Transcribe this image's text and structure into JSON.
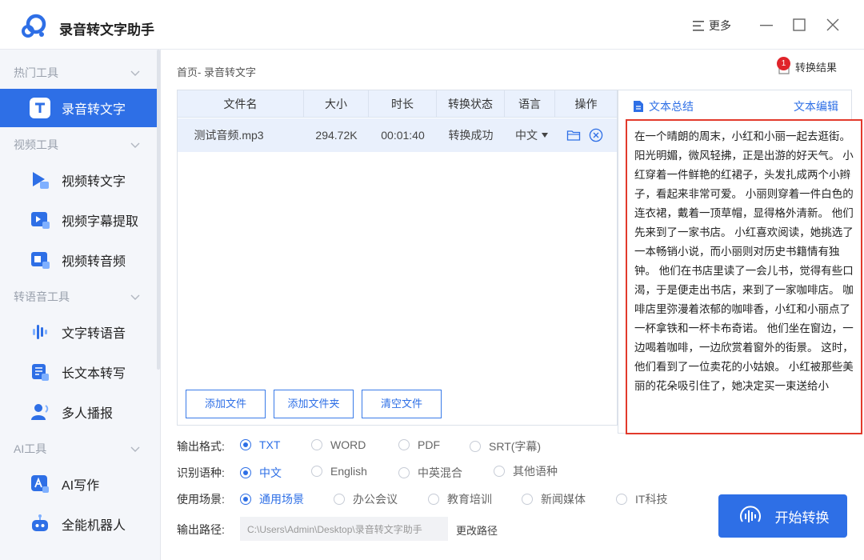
{
  "app": {
    "title": "录音转文字助手",
    "more_label": "更多"
  },
  "sidebar": {
    "groups": [
      {
        "label": "热门工具",
        "items": [
          {
            "label": "录音转文字",
            "icon": "text-t-icon",
            "active": true
          }
        ]
      },
      {
        "label": "视频工具",
        "items": [
          {
            "label": "视频转文字",
            "icon": "video-to-text-icon"
          },
          {
            "label": "视频字幕提取",
            "icon": "subtitle-extract-icon"
          },
          {
            "label": "视频转音频",
            "icon": "video-to-audio-icon"
          }
        ]
      },
      {
        "label": "转语音工具",
        "items": [
          {
            "label": "文字转语音",
            "icon": "waveform-icon"
          },
          {
            "label": "长文本转写",
            "icon": "long-text-icon"
          },
          {
            "label": "多人播报",
            "icon": "multi-speaker-icon"
          }
        ]
      },
      {
        "label": "AI工具",
        "items": [
          {
            "label": "AI写作",
            "icon": "ai-write-icon"
          },
          {
            "label": "全能机器人",
            "icon": "robot-icon"
          }
        ]
      }
    ]
  },
  "main": {
    "breadcrumb": "首页- 录音转文字",
    "result_label": "转换结果",
    "result_badge": "1",
    "table": {
      "headers": [
        "文件名",
        "大小",
        "时长",
        "转换状态",
        "语言",
        "操作"
      ],
      "rows": [
        {
          "name": "测试音频.mp3",
          "size": "294.72K",
          "duration": "00:01:40",
          "status": "转换成功",
          "language": "中文"
        }
      ]
    },
    "buttons": {
      "add_file": "添加文件",
      "add_folder": "添加文件夹",
      "clear": "清空文件"
    }
  },
  "text_panel": {
    "summary_label": "文本总结",
    "edit_label": "文本编辑",
    "content": "在一个晴朗的周末，小红和小丽一起去逛街。 阳光明媚，微风轻拂，正是出游的好天气。 小红穿着一件鲜艳的红裙子，头发扎成两个小辫子，看起来非常可爱。 小丽则穿着一件白色的连衣裙，戴着一顶草帽，显得格外清新。 他们先来到了一家书店。 小红喜欢阅读，她挑选了一本畅销小说，而小丽则对历史书籍情有独钟。 他们在书店里读了一会儿书，觉得有些口渴，于是便走出书店，来到了一家咖啡店。 咖啡店里弥漫着浓郁的咖啡香，小红和小丽点了一杯拿铁和一杯卡布奇诺。 他们坐在窗边，一边喝着咖啡，一边欣赏着窗外的街景。 这时，他们看到了一位卖花的小姑娘。 小红被那些美丽的花朵吸引住了，她决定买一束送给小"
  },
  "options": {
    "format": {
      "label": "输出格式:",
      "choices": [
        "TXT",
        "WORD",
        "PDF",
        "SRT(字幕)"
      ],
      "selected": "TXT"
    },
    "language": {
      "label": "识别语种:",
      "choices": [
        "中文",
        "English",
        "中英混合",
        "其他语种"
      ],
      "selected": "中文"
    },
    "scene": {
      "label": "使用场景:",
      "choices": [
        "通用场景",
        "办公会议",
        "教育培训",
        "新闻媒体",
        "IT科技"
      ],
      "selected": "通用场景"
    },
    "path": {
      "label": "输出路径:",
      "value": "C:\\Users\\Admin\\Desktop\\录音转文字助手",
      "change_label": "更改路径"
    }
  },
  "start_label": "开始转换",
  "colors": {
    "accent": "#2e6fe6",
    "highlight_border": "#e23a2c",
    "badge": "#e0242a"
  }
}
